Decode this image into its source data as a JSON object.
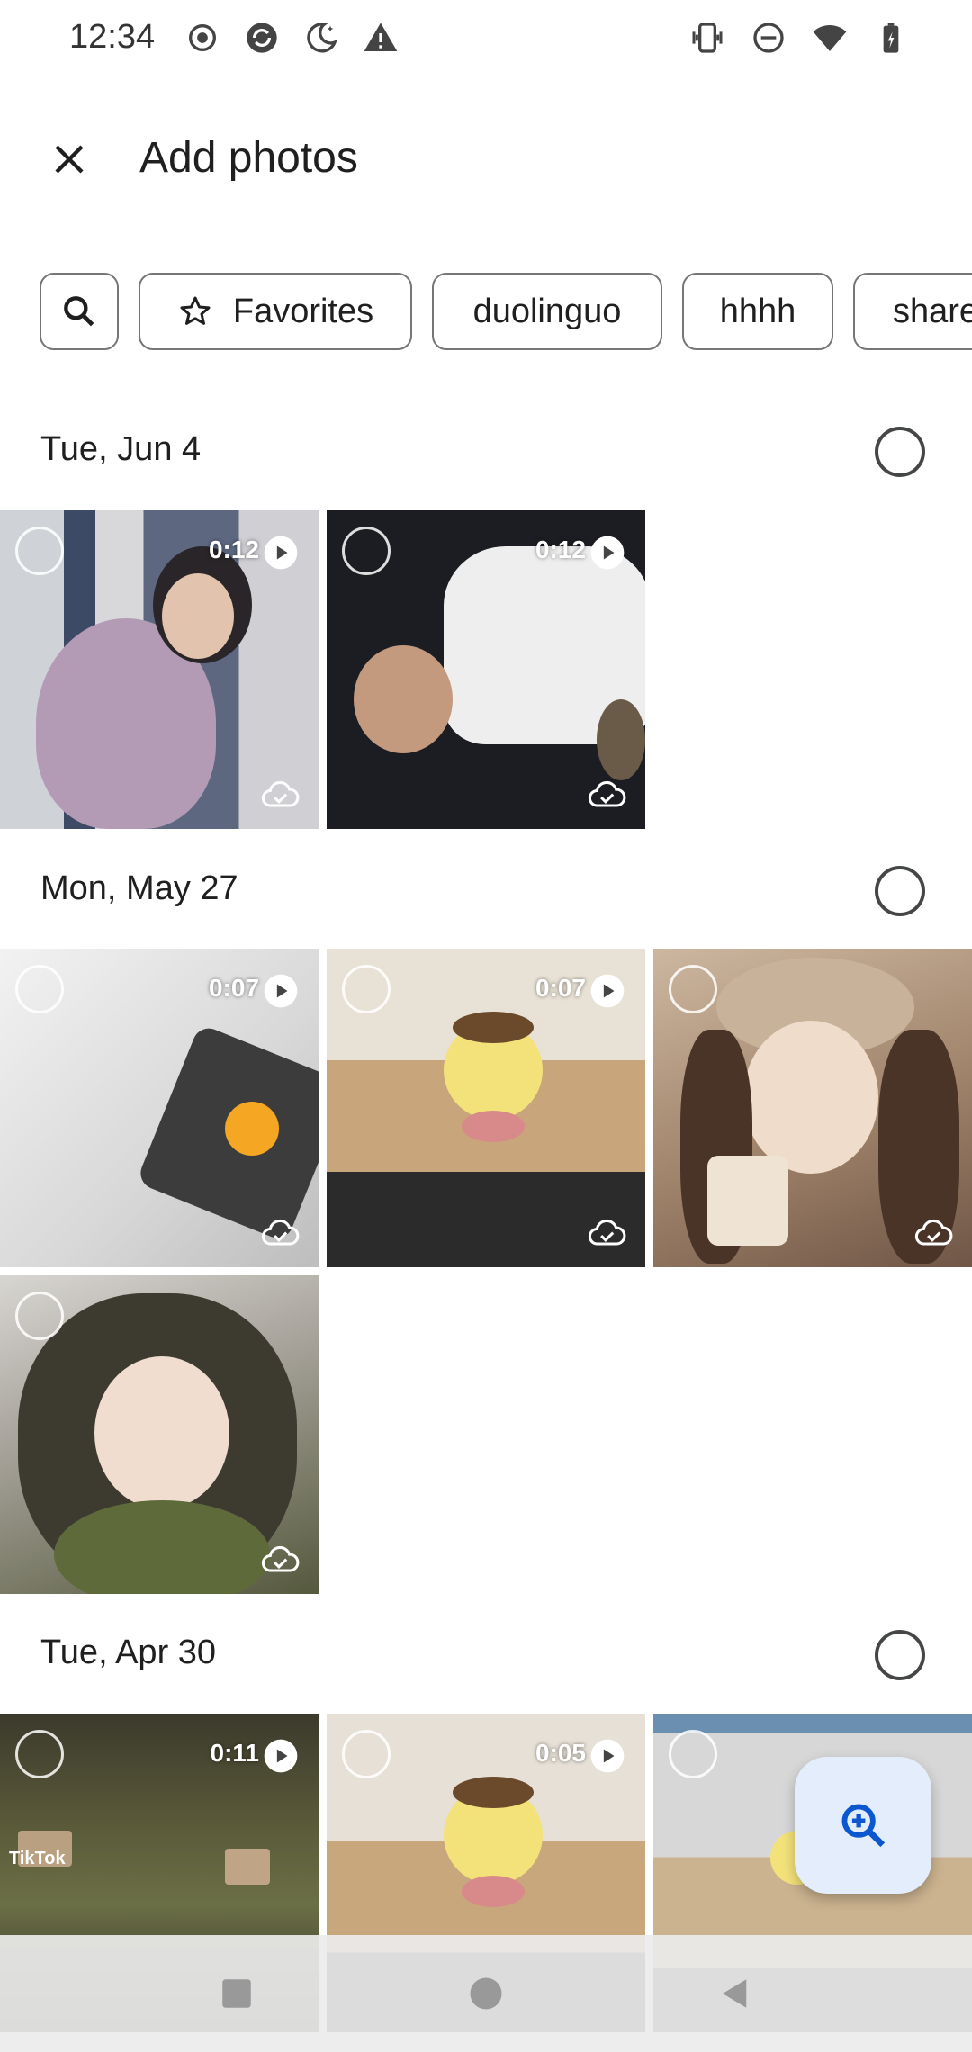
{
  "status_bar": {
    "time": "12:34",
    "left_icons": [
      "record-icon",
      "sync-icon",
      "moon-icon",
      "alert-icon"
    ],
    "right_icons": [
      "vibrate-icon",
      "dnd-icon",
      "wifi-icon",
      "battery-icon"
    ]
  },
  "header": {
    "title": "Add photos",
    "close_icon": "close-icon"
  },
  "chips": [
    {
      "label": "",
      "icon": "search-icon"
    },
    {
      "label": "Favorites",
      "icon": "star-icon"
    },
    {
      "label": "duolinguo",
      "icon": ""
    },
    {
      "label": "hhhh",
      "icon": ""
    },
    {
      "label": "share",
      "icon": ""
    }
  ],
  "sections": [
    {
      "date": "Tue, Jun 4",
      "items": [
        {
          "type": "video",
          "duration": "0:12",
          "backed_up": true
        },
        {
          "type": "video",
          "duration": "0:12",
          "backed_up": true
        }
      ]
    },
    {
      "date": "Mon, May 27",
      "items": [
        {
          "type": "video",
          "duration": "0:07",
          "backed_up": true
        },
        {
          "type": "video",
          "duration": "0:07",
          "backed_up": true
        },
        {
          "type": "photo",
          "duration": "",
          "backed_up": true
        },
        {
          "type": "photo",
          "duration": "",
          "backed_up": true
        }
      ]
    },
    {
      "date": "Tue, Apr 30",
      "items": [
        {
          "type": "video",
          "duration": "0:11",
          "backed_up": true,
          "overlay_text": "TikTok"
        },
        {
          "type": "video",
          "duration": "0:05",
          "backed_up": true
        },
        {
          "type": "photo",
          "duration": "",
          "backed_up": true
        }
      ]
    }
  ],
  "fab": {
    "icon": "zoom-in-icon"
  },
  "nav_bar": {
    "buttons": [
      "recents-icon",
      "home-icon",
      "back-icon"
    ]
  },
  "colors": {
    "fab_bg": "#e3edfb",
    "accent": "#0b57d0"
  }
}
